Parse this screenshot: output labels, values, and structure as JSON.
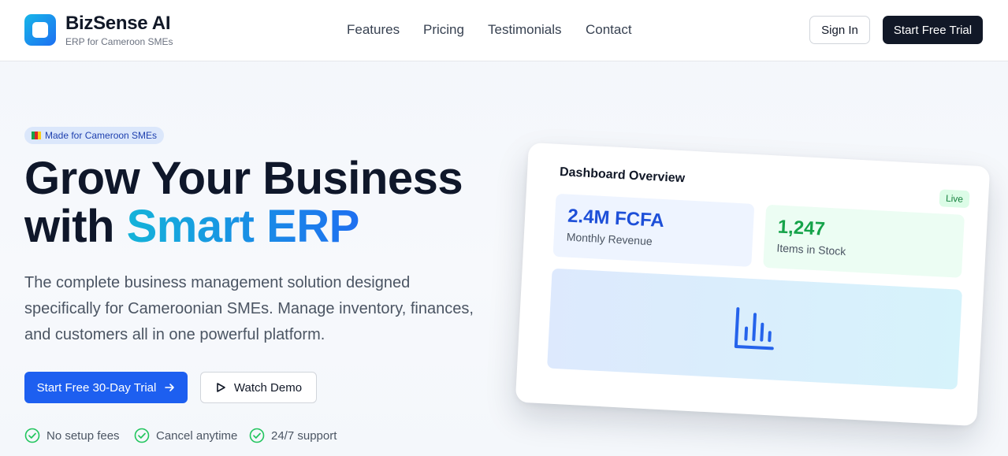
{
  "brand": {
    "name": "BizSense AI",
    "tagline": "ERP for Cameroon SMEs"
  },
  "nav": {
    "links": [
      "Features",
      "Pricing",
      "Testimonials",
      "Contact"
    ],
    "sign_in": "Sign In",
    "start_trial": "Start Free Trial"
  },
  "hero": {
    "badge": "Made for Cameroon SMEs",
    "title_line1": "Grow Your Business",
    "title_line2_prefix": "with ",
    "title_line2_accent": "Smart ERP",
    "lead": "The complete business management solution designed specifically for Cameroonian SMEs. Manage inventory, finances, and customers all in one powerful platform.",
    "cta_primary": "Start Free 30-Day Trial",
    "cta_secondary": "Watch Demo",
    "perks": [
      "No setup fees",
      "Cancel anytime",
      "24/7 support"
    ]
  },
  "dashboard": {
    "title": "Dashboard Overview",
    "status": "Live",
    "revenue_value": "2.4M FCFA",
    "revenue_label": "Monthly Revenue",
    "stock_value": "1,247",
    "stock_label": "Items in Stock",
    "chart_icon": "bar-chart-icon"
  },
  "colors": {
    "primary": "#1d5ff0",
    "dark": "#111827",
    "accent_start": "#14b3d9",
    "accent_end": "#1e6ff0",
    "success": "#16a34a"
  }
}
